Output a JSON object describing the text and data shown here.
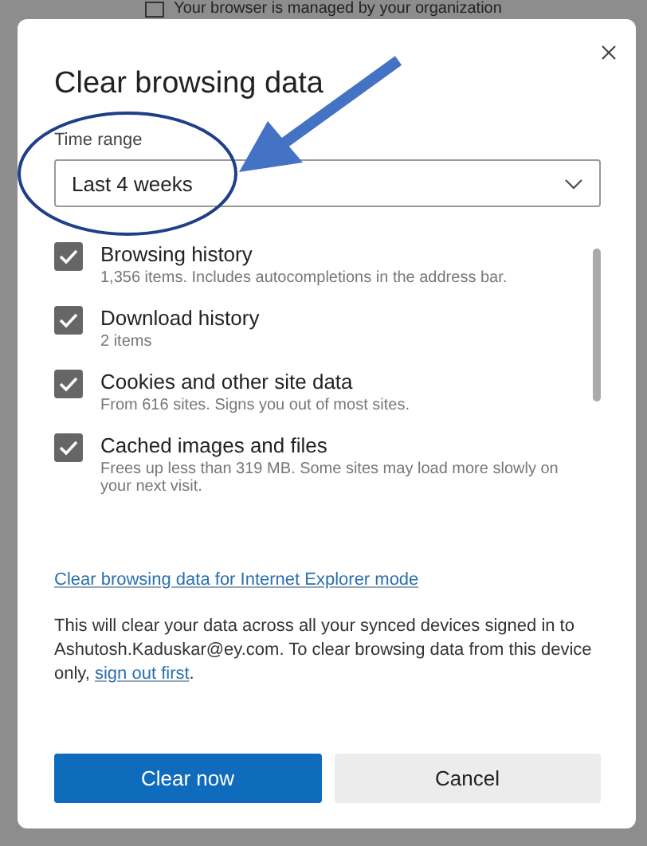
{
  "background": {
    "banner": "Your browser is managed by your organization"
  },
  "dialog": {
    "title": "Clear browsing data",
    "time_range": {
      "label": "Time range",
      "value": "Last 4 weeks"
    },
    "items": [
      {
        "title": "Browsing history",
        "description": "1,356 items. Includes autocompletions in the address bar.",
        "checked": true
      },
      {
        "title": "Download history",
        "description": "2 items",
        "checked": true
      },
      {
        "title": "Cookies and other site data",
        "description": "From 616 sites. Signs you out of most sites.",
        "checked": true
      },
      {
        "title": "Cached images and files",
        "description": "Frees up less than 319 MB. Some sites may load more slowly on your next visit.",
        "checked": true
      }
    ],
    "ie_link": "Clear browsing data for Internet Explorer mode",
    "notice": "This will clear your data across all your synced devices signed in to Ashutosh.Kaduskar@ey.com. To clear browsing data from this device only,",
    "notice_link": "sign out first",
    "notice_end": ".",
    "buttons": [
      {
        "label": "Clear now",
        "kind": "primary"
      },
      {
        "label": "Cancel",
        "kind": "secondary"
      }
    ]
  }
}
